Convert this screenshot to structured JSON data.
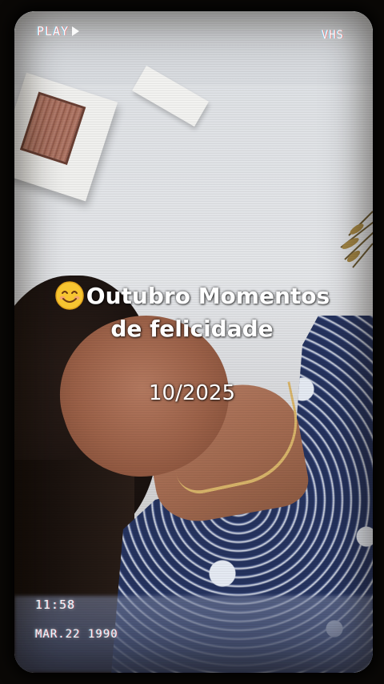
{
  "overlay": {
    "play_label": "PLAY",
    "format_label": "VHS",
    "time": "11:58",
    "date": "MAR.22 1990"
  },
  "caption": {
    "emoji": "smiling-face-emoji",
    "line1": "Outubro Momentos",
    "line2": "de felicidade",
    "date": "10/2025"
  },
  "colors": {
    "caption_text": "#ffffff",
    "dress_navy": "#25335f",
    "frame_background": "#0a0806"
  }
}
